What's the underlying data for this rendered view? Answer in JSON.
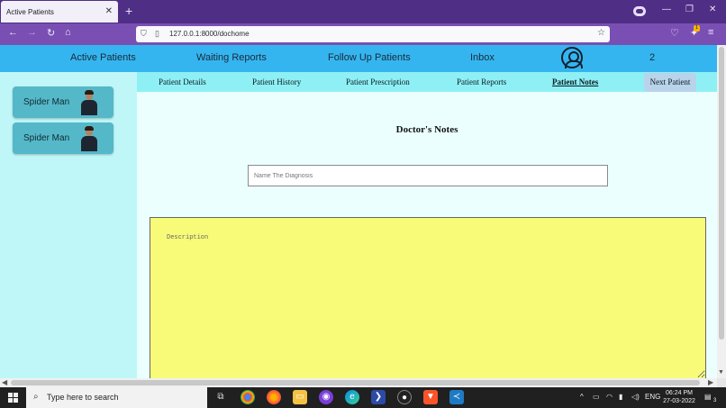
{
  "browser": {
    "tab_title": "Active Patients",
    "tab_close": "✕",
    "new_tab": "+",
    "url": "127.0.0.1:8000/dochome",
    "ext_badge": "1",
    "window": {
      "minimize": "—",
      "restore": "❐",
      "close": "✕"
    }
  },
  "topnav": {
    "links": [
      "Active Patients",
      "Waiting Reports",
      "Follow Up Patients",
      "Inbox"
    ],
    "count": "2"
  },
  "sidebar": {
    "patients": [
      {
        "name": "Spider Man"
      },
      {
        "name": "Spider Man"
      }
    ]
  },
  "subnav": {
    "items": [
      "Patient Details",
      "Patient History",
      "Patient Prescription",
      "Patient Reports",
      "Patient Notes"
    ],
    "active": "Patient Notes",
    "next_label": "Next Patient"
  },
  "notes": {
    "title": "Doctor's Notes",
    "diagnosis_placeholder": "Name The Diagnosis",
    "description_placeholder": "Description"
  },
  "taskbar": {
    "search_placeholder": "Type here to search",
    "lang": "ENG",
    "time": "06:24 PM",
    "date": "27-03-2022",
    "notif_count": "3"
  },
  "colors": {
    "browser_tabbar": "#4f2f86",
    "browser_navbar": "#7a4fb3",
    "topnav_bg": "#35b5ef",
    "sidebar_bg": "#bff7f9",
    "subnav_bg": "#8ef0f5",
    "card_bg": "#55b8c8",
    "description_bg": "#f8fb78",
    "next_button_bg": "#b9d3ea"
  }
}
